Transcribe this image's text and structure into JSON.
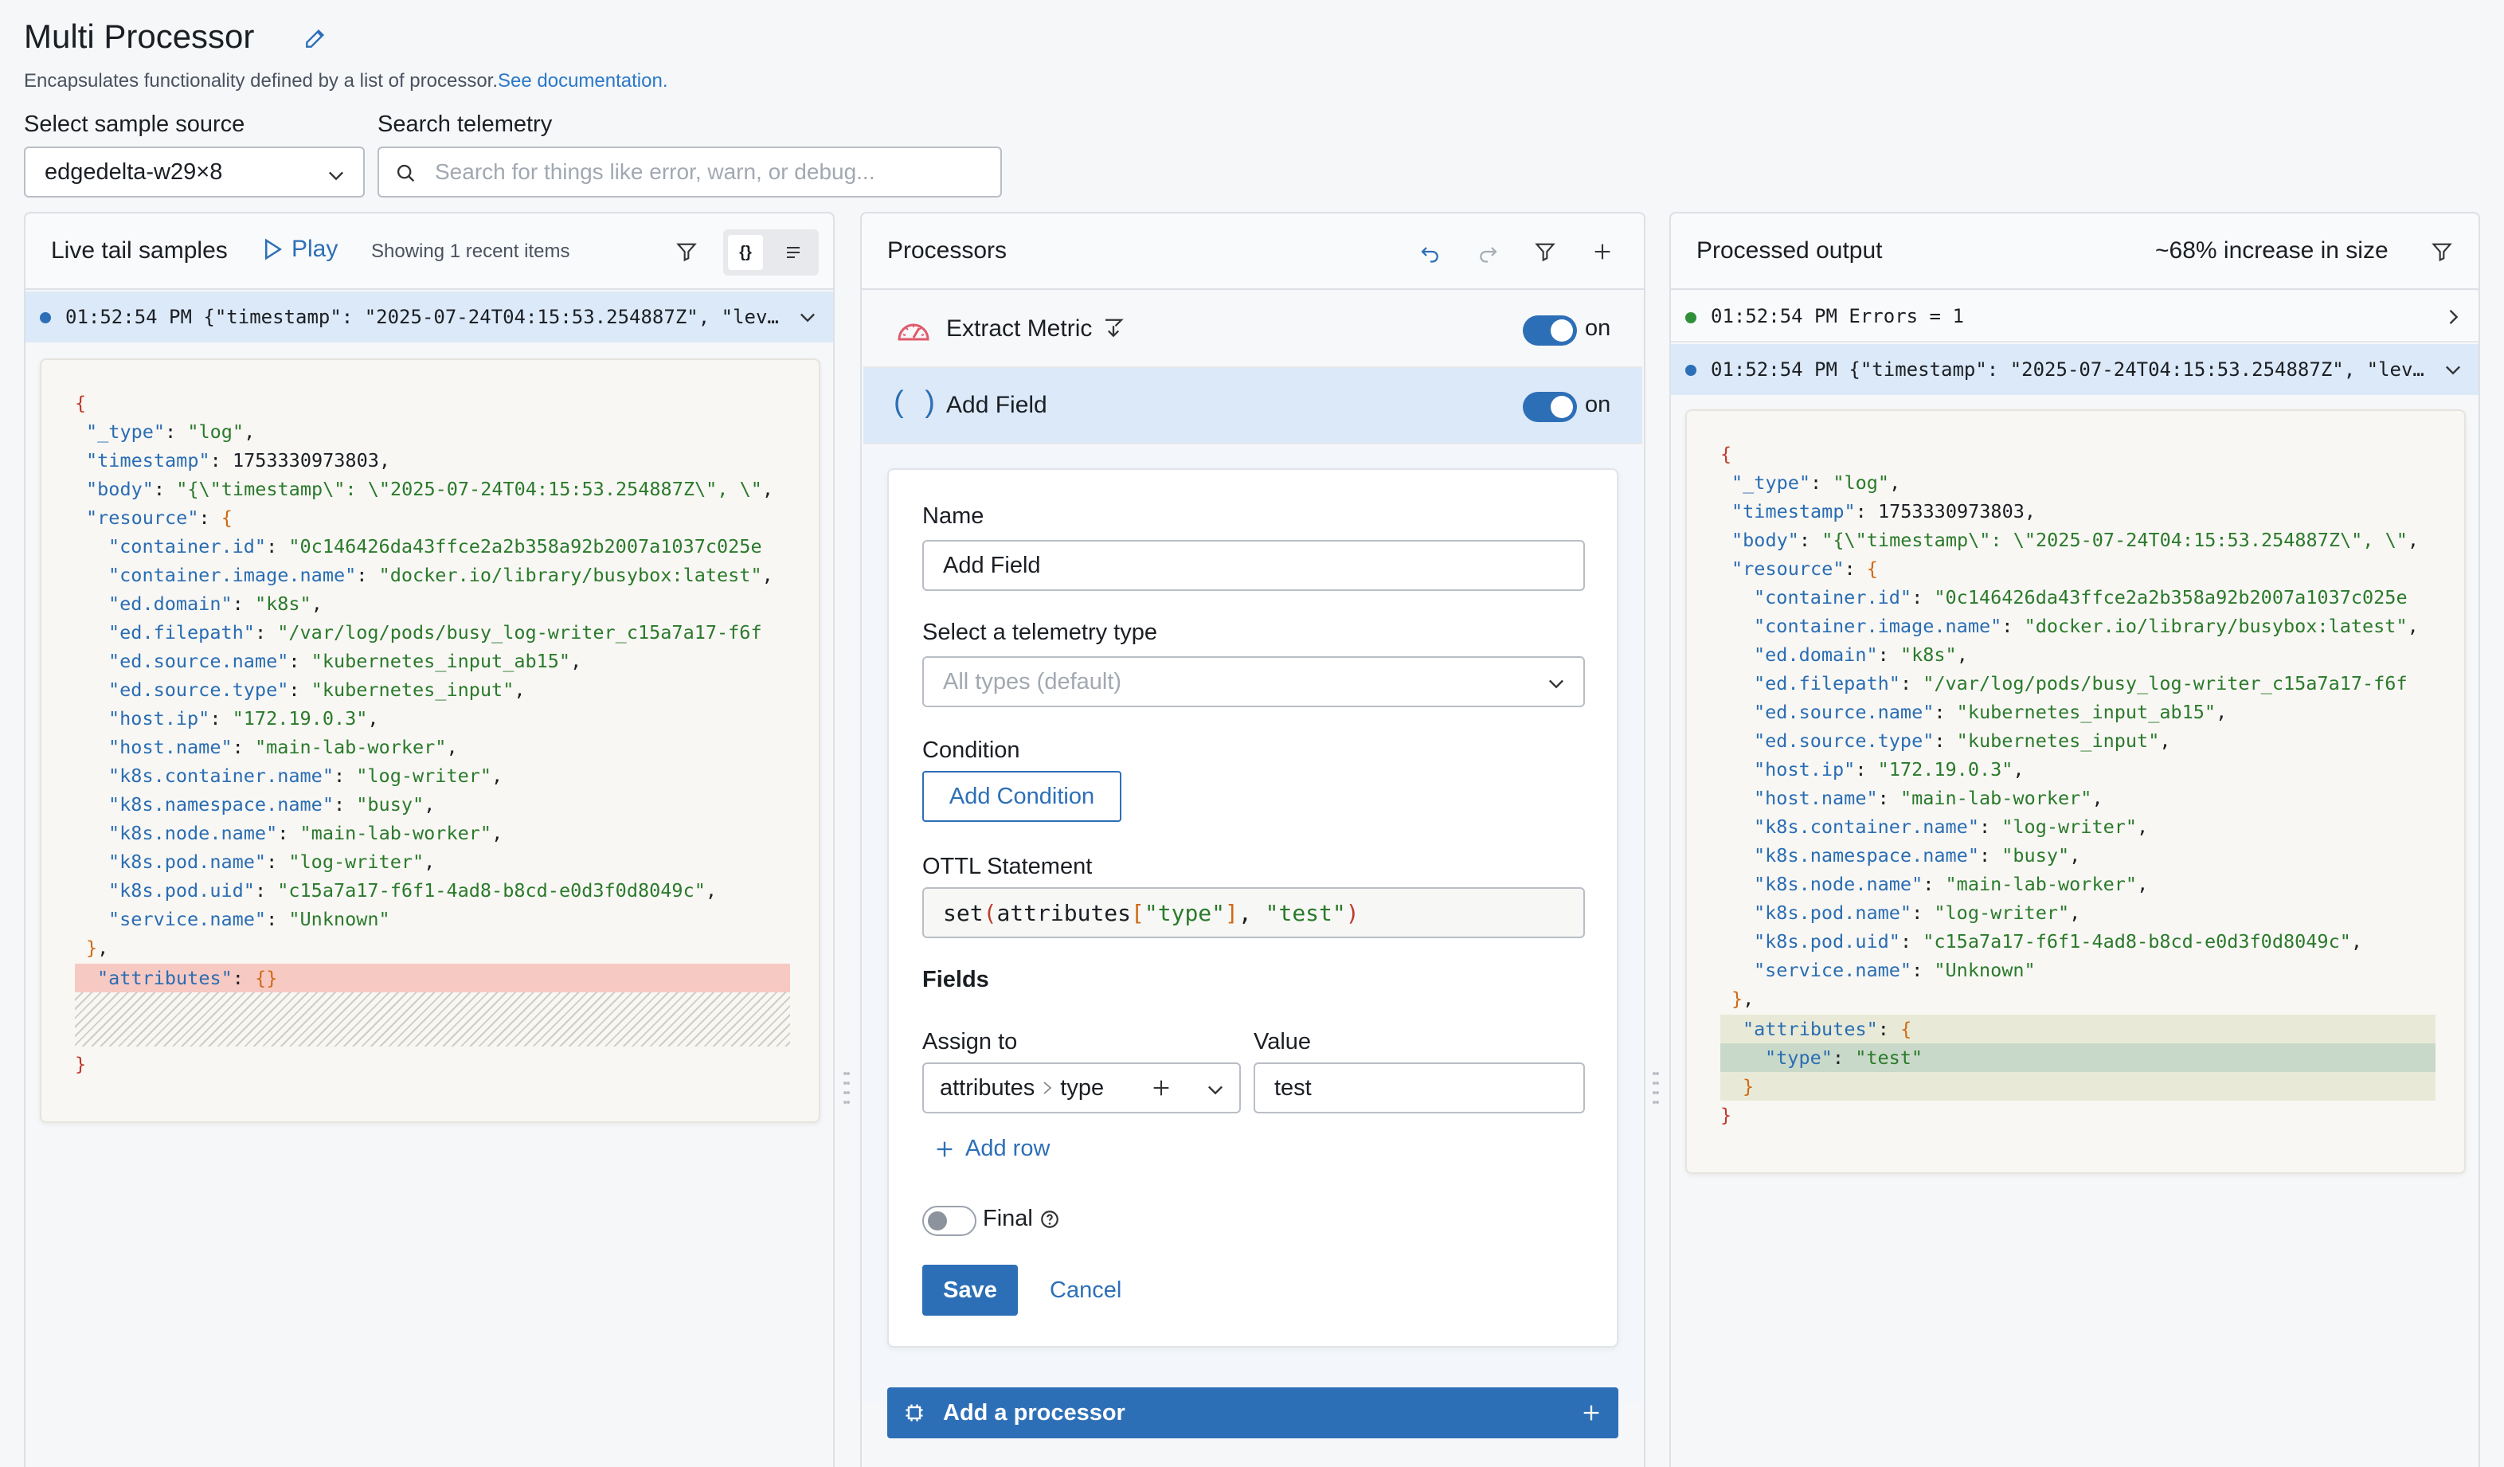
{
  "header": {
    "title": "Multi Processor",
    "subtitle": "Encapsulates functionality defined by a list of processor.",
    "doc_link": "See documentation.",
    "source_label": "Select sample source",
    "source_value": "edgedelta-w29×8",
    "search_label": "Search telemetry",
    "search_placeholder": "Search for things like error, warn, or debug..."
  },
  "left": {
    "title": "Live tail samples",
    "play_label": "Play",
    "showing": "Showing 1 recent items",
    "row_time": "01:52:54 PM",
    "row_text": "{\"timestamp\": \"2025-07-24T04:15:53.254887Z\", \"lev…",
    "attributes_key": "\"attributes\"",
    "attributes_val": "{}"
  },
  "middle": {
    "title": "Processors",
    "items": [
      {
        "label": "Extract Metric",
        "state": "on"
      },
      {
        "label": "Add Field",
        "state": "on"
      }
    ],
    "form": {
      "name_label": "Name",
      "name_value": "Add Field",
      "type_label": "Select a telemetry type",
      "type_placeholder": "All types (default)",
      "condition_label": "Condition",
      "add_condition": "Add Condition",
      "ottl_label": "OTTL Statement",
      "fields_label": "Fields",
      "assign_label": "Assign to",
      "assign_part1": "attributes",
      "assign_part2": "type",
      "value_label": "Value",
      "value_value": "test",
      "add_row": "Add row",
      "final_label": "Final",
      "save": "Save",
      "cancel": "Cancel"
    },
    "add_processor": "Add a processor"
  },
  "right": {
    "title": "Processed output",
    "size_note": "~68% increase in size",
    "rows": [
      {
        "time": "01:52:54 PM",
        "text": "Errors = 1"
      },
      {
        "time": "01:52:54 PM",
        "text": "{\"timestamp\": \"2025-07-24T04:15:53.254887Z\", \"lev…"
      }
    ]
  },
  "json_lines": [
    {
      "k": "\"_type\"",
      "v": "\"log\"",
      "t": "s",
      "ind": 1
    },
    {
      "k": "\"timestamp\"",
      "v": "1753330973803,",
      "t": "n",
      "ind": 1
    },
    {
      "k": "\"body\"",
      "v": "\"{\\\"timestamp\\\": \\\"2025-07-24T04:15:53.254887Z\\\", \\\"",
      "t": "s",
      "ind": 1
    },
    {
      "k": "\"resource\"",
      "v": "{",
      "t": "o",
      "ind": 1
    },
    {
      "k": "\"container.id\"",
      "v": "\"0c146426da43ffce2a2b358a92b2007a1037c025e",
      "t": "s",
      "ind": 2
    },
    {
      "k": "\"container.image.name\"",
      "v": "\"docker.io/library/busybox:latest\"",
      "t": "s",
      "ind": 2
    },
    {
      "k": "\"ed.domain\"",
      "v": "\"k8s\"",
      "t": "s",
      "ind": 2
    },
    {
      "k": "\"ed.filepath\"",
      "v": "\"/var/log/pods/busy_log-writer_c15a7a17-f6f",
      "t": "s",
      "ind": 2
    },
    {
      "k": "\"ed.source.name\"",
      "v": "\"kubernetes_input_ab15\"",
      "t": "s",
      "ind": 2
    },
    {
      "k": "\"ed.source.type\"",
      "v": "\"kubernetes_input\"",
      "t": "s",
      "ind": 2
    },
    {
      "k": "\"host.ip\"",
      "v": "\"172.19.0.3\"",
      "t": "s",
      "ind": 2
    },
    {
      "k": "\"host.name\"",
      "v": "\"main-lab-worker\"",
      "t": "s",
      "ind": 2
    },
    {
      "k": "\"k8s.container.name\"",
      "v": "\"log-writer\"",
      "t": "s",
      "ind": 2
    },
    {
      "k": "\"k8s.namespace.name\"",
      "v": "\"busy\"",
      "t": "s",
      "ind": 2
    },
    {
      "k": "\"k8s.node.name\"",
      "v": "\"main-lab-worker\"",
      "t": "s",
      "ind": 2
    },
    {
      "k": "\"k8s.pod.name\"",
      "v": "\"log-writer\"",
      "t": "s",
      "ind": 2
    },
    {
      "k": "\"k8s.pod.uid\"",
      "v": "\"c15a7a17-f6f1-4ad8-b8cd-e0d3f0d8049c\"",
      "t": "s",
      "ind": 2
    },
    {
      "k": "\"service.name\"",
      "v": "\"Unknown\"",
      "t": "s",
      "ind": 2,
      "last": true
    }
  ],
  "ottl": {
    "fn": "set",
    "arg1": "attributes",
    "key": "\"type\"",
    "val": "\"test\""
  },
  "added_attr": {
    "k": "\"type\"",
    "v": "\"test\""
  },
  "colors": {
    "accent": "#2d6fb7",
    "removed": "#f7c9c3",
    "added": "#c9d9c9"
  }
}
